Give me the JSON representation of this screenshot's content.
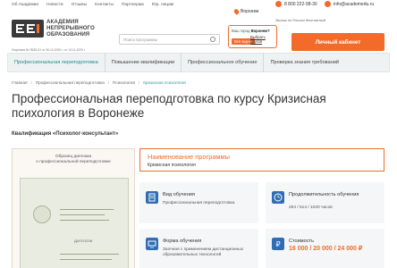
{
  "topbar": {
    "nav": [
      "Об Академии",
      "Новости",
      "Отзывы",
      "Контакты",
      "Партнерам",
      "Юр. лицам"
    ],
    "phone": "8 800 222-98-30",
    "phone_note": "Звонок по России бесплатный",
    "email": "info@academedu.ru"
  },
  "header": {
    "logo_lines": [
      "АКАДЕМИЯ",
      "НЕПРЕРЫВНОГО",
      "ОБРАЗОВАНИЯ"
    ],
    "license": "Лицензия № 9535-01 от 06.10.2020 г. от 13.11.2020 г.",
    "search_placeholder": "Поиск программы",
    "city_name": "Воронеж",
    "city_question_prefix": "Ваш город",
    "city_question_city": "Воронеж?",
    "city_yes": "Всё верно",
    "city_other": "Выбрать другой",
    "cabinet_button": "Личный кабинет"
  },
  "categories": [
    {
      "label": "Профессиональная переподготовка",
      "active": true
    },
    {
      "label": "Повышение квалификации",
      "active": false
    },
    {
      "label": "Профессиональное обучение",
      "active": false
    },
    {
      "label": "Проверка знания требований",
      "active": false
    }
  ],
  "breadcrumbs": [
    "Главная",
    "Профессиональная переподготовка",
    "Психология",
    "Кризисная психология"
  ],
  "page": {
    "title": "Профессиональная переподготовка по курсу Кризисная психология в Воронеже",
    "qualification": "Квалификация «Психолог-консультант»"
  },
  "diploma": {
    "caption_line1": "Образец диплома",
    "caption_line2": "о профессиональной переподготовке",
    "doc_title": "ДИПЛОМ"
  },
  "program": {
    "heading": "Наименование программы",
    "name": "Кризисная психология"
  },
  "info": [
    {
      "label": "Вид обучения",
      "value": "Профессиональная переподготовка",
      "icon": "document-icon",
      "color": "#2f6db5"
    },
    {
      "label": "Продолжительность обучения",
      "value": "264 / 514 / 1020 часов",
      "icon": "clock-icon",
      "color": "#f2f4f5"
    },
    {
      "label": "Форма обучения",
      "value": "Заочная с применением дистанционных образовательных технологий",
      "icon": "monitor-icon",
      "color": "#2f6db5"
    },
    {
      "label": "Стоимость",
      "value": "16 000 / 20 000 / 24 000 ₽",
      "icon": "ruble-icon",
      "color": "#2f6db5"
    }
  ],
  "colors": {
    "accent": "#f26b2b",
    "teal": "#1c8a8a",
    "blue": "#2f6db5"
  }
}
